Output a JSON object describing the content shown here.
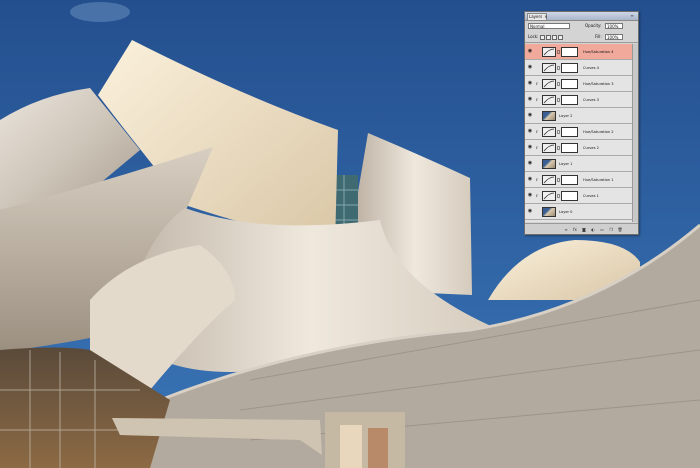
{
  "panel": {
    "tab_label": "Layers",
    "tab_close": "×",
    "menu_icon": "≡",
    "blend_mode": "Normal",
    "opacity_label": "Opacity:",
    "opacity_value": "100%",
    "lock_label": "Lock:",
    "fill_label": "Fill:",
    "fill_value": "100%"
  },
  "layers": [
    {
      "name": "Hue/Saturation 4",
      "type": "adjustment",
      "active": true,
      "eye": "◉",
      "mask": true,
      "brush": ""
    },
    {
      "name": "Curves 4",
      "type": "adjustment",
      "active": false,
      "eye": "◉",
      "mask": true,
      "brush": ""
    },
    {
      "name": "Hue/Saturation 3",
      "type": "adjustment",
      "active": false,
      "eye": "◉",
      "mask": true,
      "brush": "ℓ"
    },
    {
      "name": "Curves 3",
      "type": "adjustment",
      "active": false,
      "eye": "◉",
      "mask": true,
      "brush": "ℓ"
    },
    {
      "name": "Layer 2",
      "type": "image",
      "active": false,
      "eye": "◉",
      "mask": false,
      "brush": ""
    },
    {
      "name": "Hue/Saturation 2",
      "type": "adjustment",
      "active": false,
      "eye": "◉",
      "mask": true,
      "brush": "ℓ"
    },
    {
      "name": "Curves 2",
      "type": "adjustment",
      "active": false,
      "eye": "◉",
      "mask": true,
      "brush": "ℓ"
    },
    {
      "name": "Layer 1",
      "type": "image",
      "active": false,
      "eye": "◉",
      "mask": false,
      "brush": ""
    },
    {
      "name": "Hue/Saturation 1",
      "type": "adjustment",
      "active": false,
      "eye": "◉",
      "mask": true,
      "brush": "ℓ"
    },
    {
      "name": "Curves 1",
      "type": "adjustment",
      "active": false,
      "eye": "◉",
      "mask": true,
      "brush": "ℓ"
    },
    {
      "name": "Layer 0",
      "type": "image",
      "active": false,
      "eye": "◉",
      "mask": false,
      "brush": ""
    }
  ],
  "bottom_icons": [
    "link-icon",
    "fx-icon",
    "mask-icon",
    "adjustment-icon",
    "folder-icon",
    "new-layer-icon",
    "trash-icon"
  ],
  "bottom_glyphs": [
    "∞",
    "fx",
    "◙",
    "◐",
    "▭",
    "❐",
    "🗑"
  ],
  "colors": {
    "active_layer": "#f0a99a",
    "sky": "#2f5f9c",
    "panel": "#d4d4d4"
  }
}
